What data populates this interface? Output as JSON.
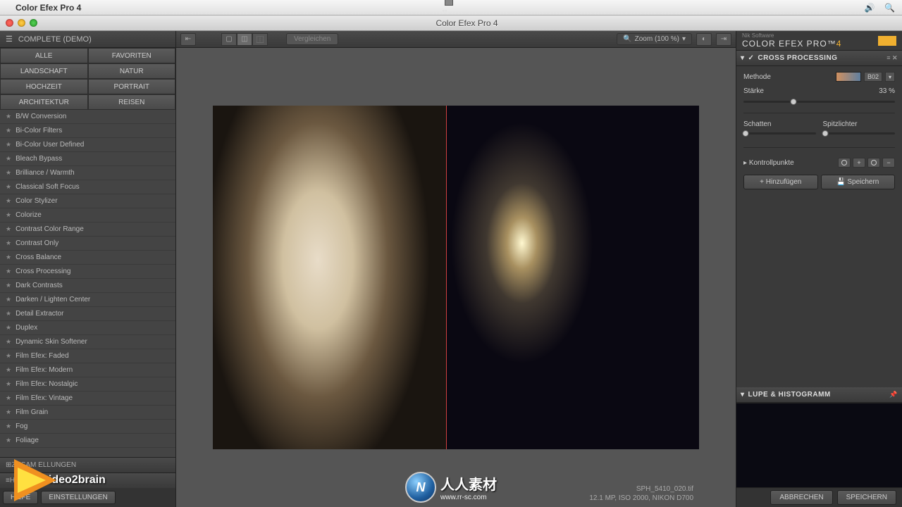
{
  "mac": {
    "app_name": "Color Efex Pro 4"
  },
  "window": {
    "title": "Color Efex Pro 4"
  },
  "left": {
    "header": "COMPLETE (DEMO)",
    "categories": [
      "ALLE",
      "FAVORITEN",
      "LANDSCHAFT",
      "NATUR",
      "HOCHZEIT",
      "PORTRAIT",
      "ARCHITEKTUR",
      "REISEN"
    ],
    "filters": [
      "B/W Conversion",
      "Bi-Color Filters",
      "Bi-Color User Defined",
      "Bleach Bypass",
      "Brilliance / Warmth",
      "Classical Soft Focus",
      "Color Stylizer",
      "Colorize",
      "Contrast Color Range",
      "Contrast Only",
      "Cross Balance",
      "Cross Processing",
      "Dark Contrasts",
      "Darken / Lighten Center",
      "Detail Extractor",
      "Duplex",
      "Dynamic Skin Softener",
      "Film Efex: Faded",
      "Film Efex: Modern",
      "Film Efex: Nostalgic",
      "Film Efex: Vintage",
      "Film Grain",
      "Fog",
      "Foliage"
    ],
    "footer1": "ZUSAM            ELLUNGEN",
    "footer2": "HISTORIE",
    "btn_help": "HILFE",
    "btn_settings": "EINSTELLUNGEN"
  },
  "center": {
    "compare": "Vergleichen",
    "zoom": "Zoom (100 %)",
    "filename": "SPH_5410_020.tif",
    "fileinfo": "12.1 MP, ISO 2000, NIKON D700"
  },
  "right": {
    "brand_small": "Nik Software",
    "brand": "COLOR EFEX PRO™",
    "brand_num": "4",
    "filter_title": "CROSS PROCESSING",
    "method_label": "Methode",
    "method_value": "B02",
    "strength_label": "Stärke",
    "strength_value": "33",
    "strength_unit": "%",
    "shadows": "Schatten",
    "highlights": "Spitzlichter",
    "controlpoints": "Kontrollpunkte",
    "add": "Hinzufügen",
    "save": "Speichern",
    "lupe": "LUPE & HISTOGRAMM",
    "cancel": "ABBRECHEN",
    "apply": "SPEICHERN"
  },
  "watermark": {
    "center_text": "人人素材",
    "center_url": "www.rr-sc.com",
    "left_text": "video2brain"
  }
}
